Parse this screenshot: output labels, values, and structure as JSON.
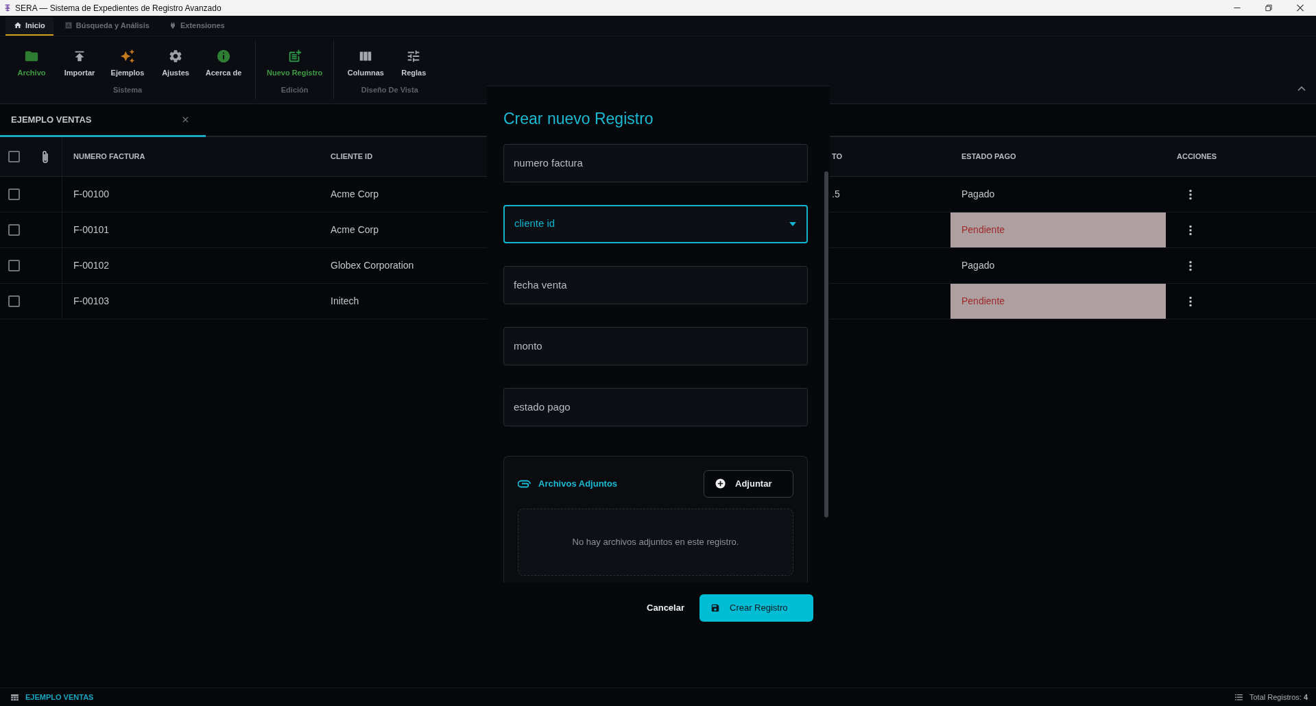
{
  "window": {
    "title": "SERA — Sistema de Expedientes de Registro Avanzado"
  },
  "ribbon": {
    "tabs": [
      {
        "label": "Inicio",
        "selected": true
      },
      {
        "label": "Búsqueda y Análisis",
        "selected": false
      },
      {
        "label": "Extensiones",
        "selected": false
      }
    ],
    "groups": [
      {
        "label": "Sistema",
        "items": [
          {
            "label": "Archivo",
            "active": true
          },
          {
            "label": "Importar",
            "active": false
          },
          {
            "label": "Ejemplos",
            "active": false
          },
          {
            "label": "Ajustes",
            "active": false
          },
          {
            "label": "Acerca de",
            "active": false
          }
        ]
      },
      {
        "label": "Edición",
        "items": [
          {
            "label": "Nuevo Registro",
            "active": true
          }
        ]
      },
      {
        "label": "Diseño De Vista",
        "items": [
          {
            "label": "Columnas",
            "active": false
          },
          {
            "label": "Reglas",
            "active": false
          }
        ]
      }
    ]
  },
  "document_tabs": [
    {
      "label": "EJEMPLO VENTAS",
      "selected": true
    }
  ],
  "table": {
    "select_all_checked": false,
    "columns": [
      "NUMERO FACTURA",
      "CLIENTE ID",
      "TO",
      "ESTADO PAGO",
      "ACCIONES"
    ],
    "rows": [
      {
        "checked": false,
        "numero_factura": "F-00100",
        "cliente_id": "Acme Corp",
        "column_3": ".5",
        "estado_pago": "Pagado",
        "highlighted": false
      },
      {
        "checked": false,
        "numero_factura": "F-00101",
        "cliente_id": "Acme Corp",
        "estado_pago": "Pendiente",
        "highlighted": true
      },
      {
        "checked": false,
        "numero_factura": "F-00102",
        "cliente_id": "Globex Corporation",
        "estado_pago": "Pagado",
        "highlighted": false
      },
      {
        "checked": false,
        "numero_factura": "F-00103",
        "cliente_id": "Initech",
        "estado_pago": "Pendiente",
        "highlighted": true
      }
    ]
  },
  "dialog": {
    "title": "Crear nuevo Registro",
    "fields": [
      {
        "kind": "text",
        "placeholder": "numero factura",
        "focused": false
      },
      {
        "kind": "select",
        "placeholder": "cliente id",
        "focused": true
      },
      {
        "kind": "text",
        "placeholder": "fecha venta",
        "focused": false
      },
      {
        "kind": "text",
        "placeholder": "monto",
        "focused": false
      },
      {
        "kind": "text",
        "placeholder": "estado pago",
        "focused": false
      }
    ],
    "attachments": {
      "title": "Archivos Adjuntos",
      "button": "Adjuntar",
      "empty_text": "No hay archivos adjuntos en este registro."
    },
    "buttons": [
      {
        "label": "Cancelar",
        "kind": "text"
      },
      {
        "label": "Crear Registro",
        "kind": "primary"
      }
    ]
  },
  "status_bar": {
    "view": "EJEMPLO VENTAS",
    "total": "Total Registros: **4**"
  }
}
